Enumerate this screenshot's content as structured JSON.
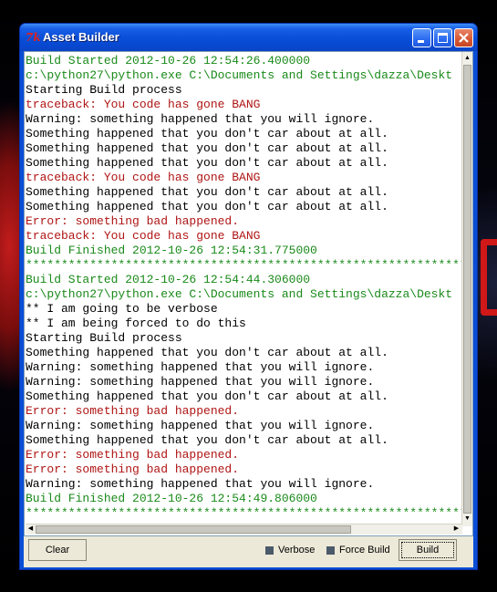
{
  "window": {
    "title": "Asset Builder",
    "icon": "tk-feather-icon",
    "buttons": [
      "minimize",
      "maximize",
      "close"
    ]
  },
  "colors": {
    "info": "#1a8a1a",
    "normal": "#000000",
    "error": "#b01515",
    "separator": "#1a8a1a"
  },
  "log": [
    {
      "type": "info",
      "text": "Build Started 2012-10-26 12:54:26.400000"
    },
    {
      "type": "info",
      "text": "c:\\python27\\python.exe C:\\Documents and Settings\\dazza\\Deskt"
    },
    {
      "type": "normal",
      "text": "Starting Build process"
    },
    {
      "type": "error",
      "text": "traceback: You code has gone BANG"
    },
    {
      "type": "normal",
      "text": "Warning: something happened that you will ignore."
    },
    {
      "type": "normal",
      "text": "Something happened that you don't car about at all."
    },
    {
      "type": "normal",
      "text": "Something happened that you don't car about at all."
    },
    {
      "type": "normal",
      "text": "Something happened that you don't car about at all."
    },
    {
      "type": "error",
      "text": "traceback: You code has gone BANG"
    },
    {
      "type": "normal",
      "text": "Something happened that you don't car about at all."
    },
    {
      "type": "normal",
      "text": "Something happened that you don't car about at all."
    },
    {
      "type": "error",
      "text": "Error: something bad happened."
    },
    {
      "type": "error",
      "text": "traceback: You code has gone BANG"
    },
    {
      "type": "info",
      "text": "Build Finished 2012-10-26 12:54:31.775000"
    },
    {
      "type": "info",
      "text": "********************************************************************"
    },
    {
      "type": "info",
      "text": "Build Started 2012-10-26 12:54:44.306000"
    },
    {
      "type": "info",
      "text": "c:\\python27\\python.exe C:\\Documents and Settings\\dazza\\Deskt"
    },
    {
      "type": "normal",
      "text": "** I am going to be verbose"
    },
    {
      "type": "normal",
      "text": "** I am being forced to do this"
    },
    {
      "type": "normal",
      "text": "Starting Build process"
    },
    {
      "type": "normal",
      "text": "Something happened that you don't car about at all."
    },
    {
      "type": "normal",
      "text": "Warning: something happened that you will ignore."
    },
    {
      "type": "normal",
      "text": "Warning: something happened that you will ignore."
    },
    {
      "type": "normal",
      "text": "Something happened that you don't car about at all."
    },
    {
      "type": "error",
      "text": "Error: something bad happened."
    },
    {
      "type": "normal",
      "text": "Warning: something happened that you will ignore."
    },
    {
      "type": "normal",
      "text": "Something happened that you don't car about at all."
    },
    {
      "type": "error",
      "text": "Error: something bad happened."
    },
    {
      "type": "error",
      "text": "Error: something bad happened."
    },
    {
      "type": "normal",
      "text": "Warning: something happened that you will ignore."
    },
    {
      "type": "info",
      "text": "Build Finished 2012-10-26 12:54:49.806000"
    },
    {
      "type": "info",
      "text": "********************************************************************"
    }
  ],
  "controls": {
    "clear_label": "Clear",
    "verbose_label": "Verbose",
    "verbose_checked": false,
    "force_build_label": "Force Build",
    "force_build_checked": false,
    "build_label": "Build"
  },
  "scrollbars": {
    "vertical": {
      "up_arrow": "▲",
      "down_arrow": "▼"
    },
    "horizontal": {
      "left_arrow": "◀",
      "right_arrow": "▶"
    }
  }
}
